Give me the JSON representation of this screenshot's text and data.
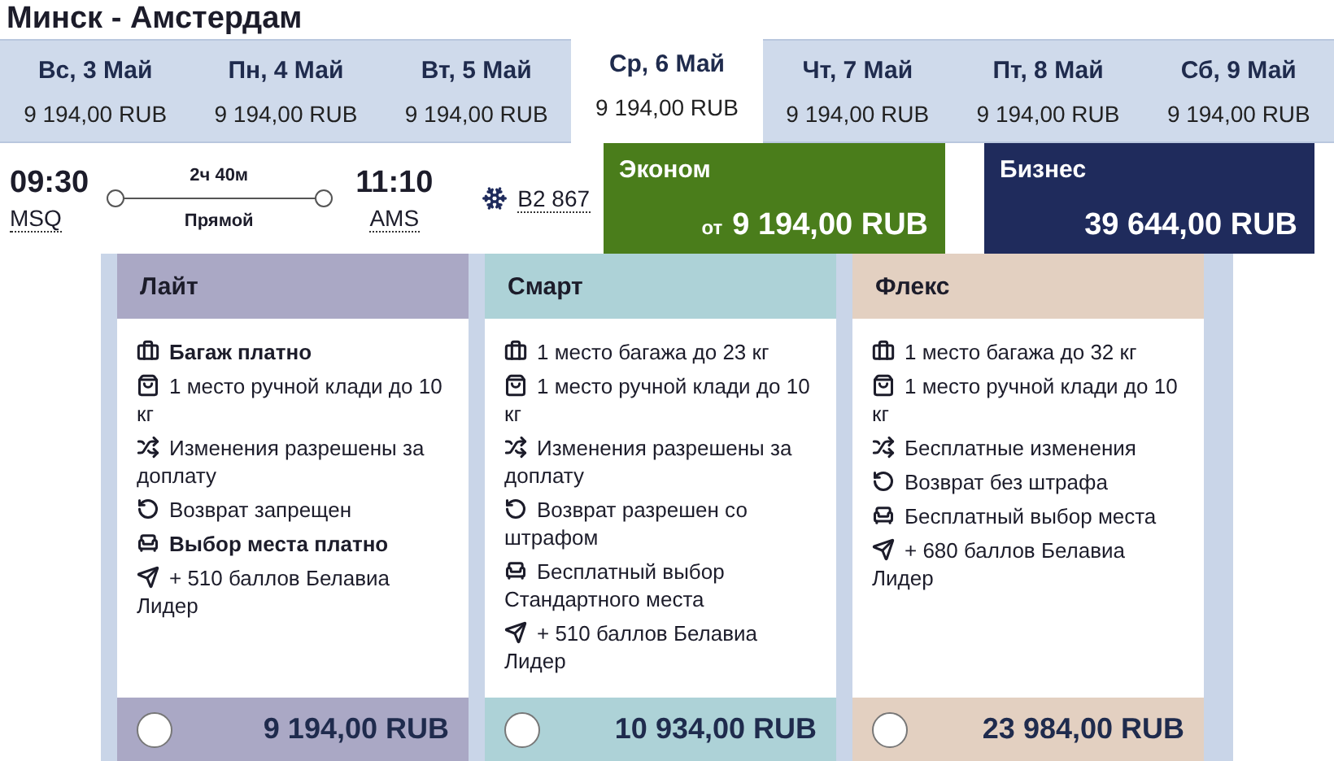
{
  "route": "Минск - Амстердам",
  "dates": [
    {
      "day": "Вс, 3 Май",
      "price": "9 194,00 RUB",
      "selected": false
    },
    {
      "day": "Пн, 4 Май",
      "price": "9 194,00 RUB",
      "selected": false
    },
    {
      "day": "Вт, 5 Май",
      "price": "9 194,00 RUB",
      "selected": false
    },
    {
      "day": "Ср, 6 Май",
      "price": "9 194,00 RUB",
      "selected": true
    },
    {
      "day": "Чт, 7 Май",
      "price": "9 194,00 RUB",
      "selected": false
    },
    {
      "day": "Пт, 8 Май",
      "price": "9 194,00 RUB",
      "selected": false
    },
    {
      "day": "Сб, 9 Май",
      "price": "9 194,00 RUB",
      "selected": false
    }
  ],
  "flight": {
    "departure_time": "09:30",
    "departure_airport": "MSQ",
    "duration": "2ч 40м",
    "stops": "Прямой",
    "arrival_time": "11:10",
    "arrival_airport": "AMS",
    "flight_number": "B2 867"
  },
  "classes": [
    {
      "name": "Эконом",
      "prefix": "от",
      "price": "9 194,00 RUB",
      "color": "#4a7d1b"
    },
    {
      "name": "Бизнес",
      "price": "39 644,00 RUB",
      "color": "#1f2b5c"
    }
  ],
  "fares": [
    {
      "name": "Лайт",
      "color": "#aaa8c5",
      "selected": false,
      "price": "9 194,00 RUB",
      "features": [
        {
          "kind": "baggage",
          "text": "Багаж платно",
          "bold": true
        },
        {
          "kind": "handbag",
          "text": "1 место ручной клади до 10 кг",
          "bold": false
        },
        {
          "kind": "change",
          "text": "Изменения разрешены за доплату",
          "bold": false
        },
        {
          "kind": "refund",
          "text": "Возврат запрещен",
          "bold": false
        },
        {
          "kind": "seat",
          "text": "Выбор места платно",
          "bold": true
        },
        {
          "kind": "miles",
          "text": "+ 510 баллов Белавиа Лидер",
          "bold": false
        }
      ]
    },
    {
      "name": "Смарт",
      "color": "#add2d7",
      "selected": false,
      "price": "10 934,00 RUB",
      "features": [
        {
          "kind": "baggage",
          "text": "1 место багажа до 23 кг",
          "bold": false
        },
        {
          "kind": "handbag",
          "text": "1 место ручной клади до 10 кг",
          "bold": false
        },
        {
          "kind": "change",
          "text": "Изменения разрешены за доплату",
          "bold": false
        },
        {
          "kind": "refund",
          "text": "Возврат разрешен со штрафом",
          "bold": false
        },
        {
          "kind": "seat",
          "text": "Бесплатный выбор Стандартного места",
          "bold": false
        },
        {
          "kind": "miles",
          "text": "+ 510 баллов Белавиа Лидер",
          "bold": false
        }
      ]
    },
    {
      "name": "Флекс",
      "color": "#e3d0c1",
      "selected": false,
      "price": "23 984,00 RUB",
      "features": [
        {
          "kind": "baggage",
          "text": "1 место багажа до 32 кг",
          "bold": false
        },
        {
          "kind": "handbag",
          "text": "1 место ручной клади до 10 кг",
          "bold": false
        },
        {
          "kind": "change",
          "text": "Бесплатные изменения",
          "bold": false
        },
        {
          "kind": "refund",
          "text": "Возврат без штрафа",
          "bold": false
        },
        {
          "kind": "seat",
          "text": "Бесплатный выбор места",
          "bold": false
        },
        {
          "kind": "miles",
          "text": "+ 680 баллов Белавиа Лидер",
          "bold": false
        }
      ]
    }
  ]
}
